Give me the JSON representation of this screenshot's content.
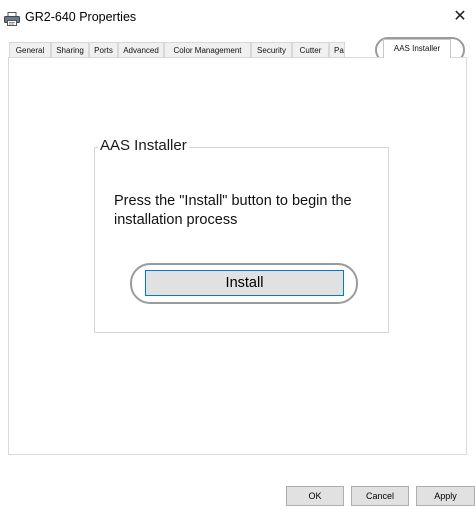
{
  "window": {
    "title": "GR2-640 Properties",
    "close_glyph": "✕"
  },
  "tabs": [
    {
      "label": "General"
    },
    {
      "label": "Sharing"
    },
    {
      "label": "Ports"
    },
    {
      "label": "Advanced"
    },
    {
      "label": "Color Management"
    },
    {
      "label": "Security"
    },
    {
      "label": "Cutter"
    },
    {
      "label": "Pa"
    },
    {
      "label": "AAS Installer",
      "active": true
    }
  ],
  "group": {
    "title": "AAS Installer",
    "message": "Press the \"Install\" button to begin the installation process",
    "install_label": "Install"
  },
  "footer": {
    "ok_label": "OK",
    "cancel_label": "Cancel",
    "apply_label": "Apply"
  },
  "colors": {
    "focus_border": "#0078d7",
    "button_face": "#e1e1e1",
    "highlight_ring": "#9b9b9b"
  },
  "icons": {
    "title_icon": "printer-icon",
    "close_icon": "close-icon"
  }
}
